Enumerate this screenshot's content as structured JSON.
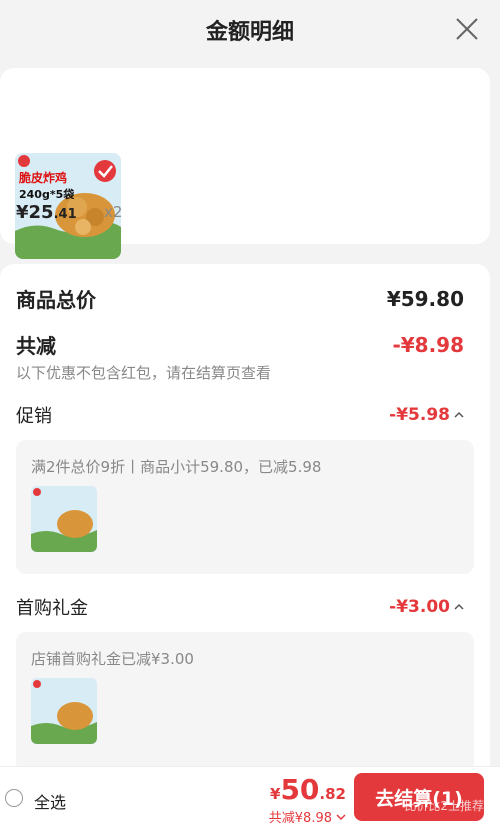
{
  "header": {
    "title": "金额明细"
  },
  "product": {
    "image_badge": "脆皮炸鸡",
    "image_spec": "240g*5袋",
    "price_symbol": "¥",
    "price_int": "25",
    "price_dec": ".41",
    "quantity": "x2"
  },
  "summary": {
    "goods_total_label": "商品总价",
    "goods_total_value": "¥59.80",
    "total_reduce_label": "共减",
    "total_reduce_value": "-¥8.98",
    "note": "以下优惠不包含红包，请在结算页查看"
  },
  "promotion": {
    "label": "促销",
    "value": "-¥5.98",
    "detail": "满2件总价9折丨商品小计59.80，已减5.98"
  },
  "first_gift": {
    "label": "首购礼金",
    "value": "-¥3.00",
    "detail": "店铺首购礼金已减¥3.00"
  },
  "bottom": {
    "select_all": "全选",
    "total_symbol": "¥",
    "total_int": "50",
    "total_dec": ".82",
    "reduce_text": "共减¥8.98",
    "checkout_label": "去结算(1)",
    "watermark": "比价比2上推荐"
  },
  "colors": {
    "accent": "#e4393c"
  }
}
